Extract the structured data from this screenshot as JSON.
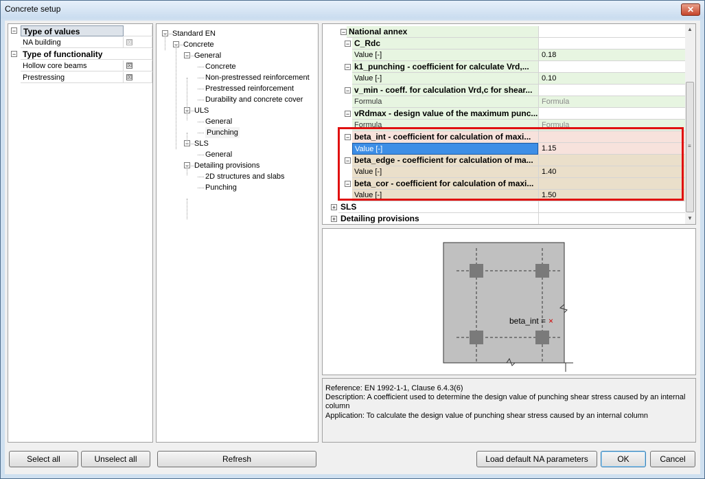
{
  "window": {
    "title": "Concrete setup",
    "close_glyph": "✕"
  },
  "options": {
    "rows": [
      {
        "label": "Type of values",
        "type": "header",
        "expander": "−"
      },
      {
        "label": "NA building",
        "type": "item",
        "checked": "☒"
      },
      {
        "label": "Type of functionality",
        "type": "header",
        "expander": "−"
      },
      {
        "label": "Hollow core beams",
        "type": "item",
        "checked": "☒"
      },
      {
        "label": "Prestressing",
        "type": "item",
        "checked": "☒"
      }
    ]
  },
  "tree": {
    "nodes": [
      {
        "label": "Standard EN",
        "expander": "−"
      },
      {
        "label": "Concrete",
        "expander": "−"
      },
      {
        "label": "General",
        "expander": "−"
      },
      {
        "label": "Concrete"
      },
      {
        "label": "Non-prestressed reinforcement"
      },
      {
        "label": "Prestressed reinforcement"
      },
      {
        "label": "Durability and concrete cover"
      },
      {
        "label": "ULS",
        "expander": "−"
      },
      {
        "label": "General"
      },
      {
        "label": "Punching"
      },
      {
        "label": "SLS",
        "expander": "−"
      },
      {
        "label": "General"
      },
      {
        "label": "Detailing provisions",
        "expander": "−"
      },
      {
        "label": "2D structures and slabs"
      },
      {
        "label": "Punching"
      }
    ]
  },
  "grid": {
    "rows": [
      {
        "kind": "group",
        "label": "National annex",
        "value": "",
        "expander": "−"
      },
      {
        "kind": "param",
        "label": "C_Rdc",
        "value": "",
        "expander": "−"
      },
      {
        "kind": "value",
        "label": "Value [-]",
        "value": "0.18"
      },
      {
        "kind": "param",
        "label": "k1_punching - coefficient for calculate Vrd,...",
        "value": "",
        "expander": "−"
      },
      {
        "kind": "value",
        "label": "Value [-]",
        "value": "0.10"
      },
      {
        "kind": "param",
        "label": "v_min - coeff. for calculation Vrd,c for shear...",
        "value": "",
        "expander": "−"
      },
      {
        "kind": "formula",
        "label": "Formula",
        "value": "Formula"
      },
      {
        "kind": "param",
        "label": "vRdmax - design value of the maximum punc...",
        "value": "",
        "expander": "−"
      },
      {
        "kind": "formula",
        "label": "Formula",
        "value": "Formula"
      },
      {
        "kind": "param",
        "label": "beta_int - coefficient for calculation of maxi...",
        "value": "",
        "expander": "−"
      },
      {
        "kind": "selected",
        "label": "Value [-]",
        "value": "1.15"
      },
      {
        "kind": "param",
        "label": "beta_edge - coefficient for calculation of ma...",
        "value": "",
        "expander": "−"
      },
      {
        "kind": "value",
        "label": "Value [-]",
        "value": "1.40"
      },
      {
        "kind": "param",
        "label": "beta_cor - coefficient for calculation of maxi...",
        "value": "",
        "expander": "−"
      },
      {
        "kind": "value",
        "label": "Value [-]",
        "value": "1.50"
      },
      {
        "kind": "group",
        "label": "SLS",
        "value": "",
        "expander": "+"
      },
      {
        "kind": "group",
        "label": "Detailing provisions",
        "value": "",
        "expander": "+"
      }
    ],
    "highlight_color": "#e01010"
  },
  "preview": {
    "label": "beta_int",
    "marker": "= ×"
  },
  "description": {
    "reference": "Reference:  EN 1992-1-1, Clause 6.4.3(6)",
    "description": " Description:  A coefficient used to determine the design value of punching shear stress caused by an internal column",
    "application": "Application:  To calculate the design value of punching shear stress caused by an internal column"
  },
  "buttons": {
    "select_all": "Select all",
    "unselect_all": "Unselect all",
    "refresh": "Refresh",
    "load_defaults": "Load default NA parameters",
    "ok": "OK",
    "cancel": "Cancel"
  }
}
